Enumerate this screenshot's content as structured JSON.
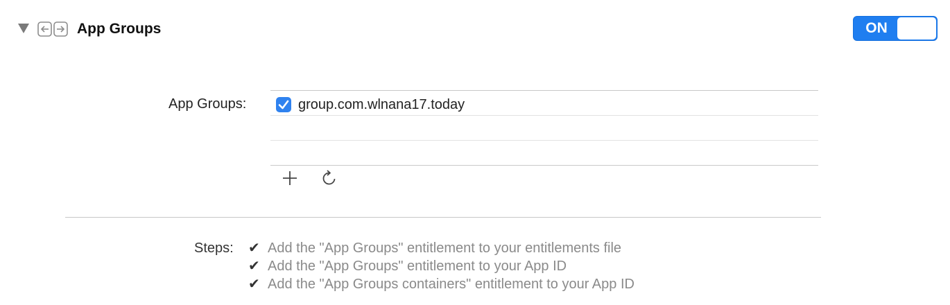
{
  "header": {
    "title": "App Groups",
    "icon": "app-groups-icon",
    "disclosure_icon": "disclosure-triangle-down-icon"
  },
  "toggle": {
    "label": "ON",
    "state": "on",
    "color": "#1f7ef0"
  },
  "groups": {
    "label": "App Groups:",
    "items": [
      {
        "name": "group.com.wlnana17.today",
        "checked": true
      },
      {
        "name": "",
        "checked": false
      }
    ],
    "add_icon": "plus-icon",
    "refresh_icon": "refresh-icon"
  },
  "steps": {
    "label": "Steps:",
    "items": [
      {
        "check": "✔",
        "text": "Add the \"App Groups\" entitlement to your entitlements file"
      },
      {
        "check": "✔",
        "text": "Add the \"App Groups\" entitlement to your App ID"
      },
      {
        "check": "✔",
        "text": "Add the \"App Groups containers\" entitlement to your App ID"
      }
    ]
  }
}
